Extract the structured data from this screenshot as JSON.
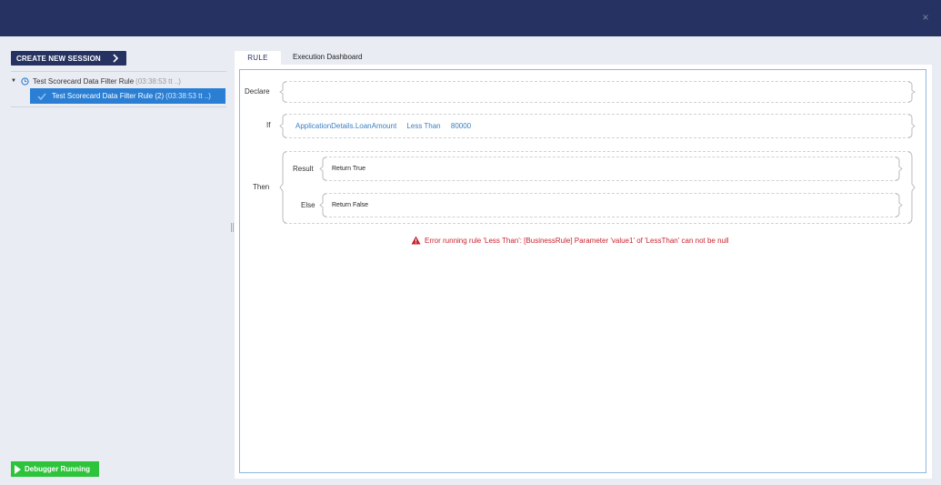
{
  "left_panel": {
    "create_session_label": "CREATE NEW SESSION",
    "session": {
      "label": "Test Scorecard Data Filter Rule",
      "time": "(03:38:53 tt ..)"
    },
    "selected_session": {
      "label": "Test Scorecard Data Filter Rule (2)",
      "time": "(03:38:53 tt ..)"
    },
    "debugger_status": "Debugger Running"
  },
  "tabs": [
    {
      "label": "RULE",
      "active": true
    },
    {
      "label": "Execution Dashboard",
      "active": false
    }
  ],
  "rule": {
    "declare_label": "Declare",
    "if_label": "If",
    "condition": {
      "left": "ApplicationDetails.LoanAmount",
      "operator": "Less Than",
      "right": "80000"
    },
    "then_label": "Then",
    "result_label": "Result",
    "result_value": "Return True",
    "else_label": "Else",
    "else_value": "Return False"
  },
  "error_message": "Error running rule 'Less Than': [BusinessRule] Parameter 'value1' of 'LessThan' can not be null",
  "colors": {
    "header": "#263362",
    "selection": "#2a7fd4",
    "running": "#2dc43b",
    "error": "#c8232f",
    "expression": "#3a7fc2"
  }
}
